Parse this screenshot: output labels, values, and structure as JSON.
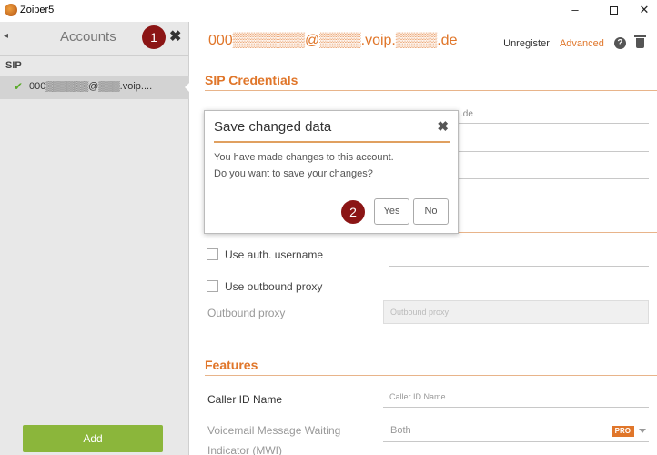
{
  "window": {
    "title": "Zoiper5",
    "minimize": "–",
    "close": "✕"
  },
  "sidebar": {
    "back": "◂",
    "title": "Accounts",
    "close": "✖",
    "section": "SIP",
    "account_label": "000▒▒▒▒▒▒@▒▒▒.voip....",
    "add_label": "Add"
  },
  "annotations": {
    "badge1": "1",
    "badge2": "2"
  },
  "header": {
    "account_title": "000▒▒▒▒▒▒▒@▒▒▒▒.voip.▒▒▒▒.de",
    "unregister": "Unregister",
    "advanced": "Advanced",
    "help": "?"
  },
  "sections": {
    "sip_credentials": "SIP Credentials",
    "features": "Features"
  },
  "background_fields": {
    "domain_fragment": ".de"
  },
  "checkboxes": {
    "auth_username": "Use auth. username",
    "outbound_proxy": "Use outbound proxy"
  },
  "form": {
    "outbound_proxy_label": "Outbound proxy",
    "outbound_proxy_placeholder": "Outbound proxy",
    "caller_id_label": "Caller ID Name",
    "caller_id_placeholder": "Caller ID Name",
    "voicemail_label_line1": "Voicemail Message Waiting",
    "voicemail_label_line2": "Indicator (MWI)",
    "voicemail_value": "Both",
    "pro_badge": "PRO"
  },
  "dialog": {
    "title": "Save changed data",
    "close": "✖",
    "message_line1": "You have made changes to this account.",
    "message_line2": "Do you want to save your changes?",
    "yes": "Yes",
    "no": "No"
  },
  "colors": {
    "accent": "#e0762a",
    "add_button": "#8bb63b",
    "badge": "#8b1515",
    "check": "#5aaa2a"
  }
}
